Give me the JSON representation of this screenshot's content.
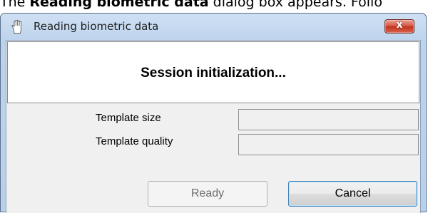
{
  "doc": {
    "prefix": "The ",
    "bold": "Reading biometric data",
    "suffix": " dialog box appears. Follo"
  },
  "dialog": {
    "title": "Reading biometric data",
    "close_label": "x",
    "status": "Session initialization...",
    "fields": {
      "template_size_label": "Template size",
      "template_size_value": "",
      "template_quality_label": "Template quality",
      "template_quality_value": ""
    },
    "buttons": {
      "ready_label": "Ready",
      "cancel_label": "Cancel"
    }
  },
  "colors": {
    "close_red": "#c2301c",
    "focus_blue": "#3c7fb1"
  },
  "icons": {
    "title_icon": "hand-icon",
    "close_icon": "close-icon"
  }
}
